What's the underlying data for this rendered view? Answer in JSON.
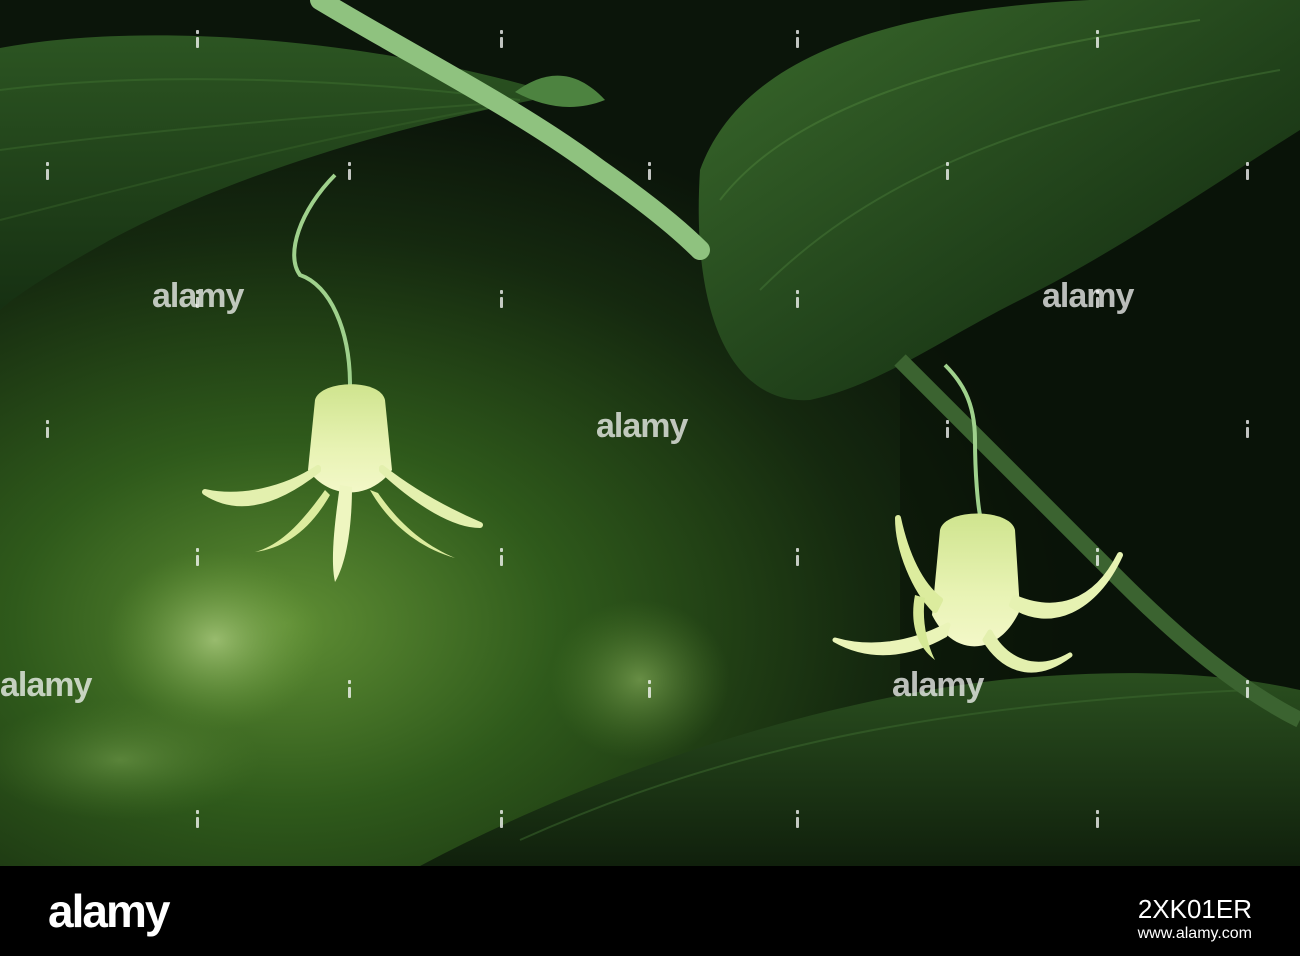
{
  "watermark": {
    "text": "alamy"
  },
  "footer": {
    "logo": "alamy",
    "image_id": "2XK01ER",
    "site": "www.alamy.com"
  },
  "colors": {
    "background": "#0d1a0b",
    "leaf": "#2f5a23",
    "stem": "#8fc27f",
    "flower": "#dfeea2",
    "footer": "#000000"
  }
}
